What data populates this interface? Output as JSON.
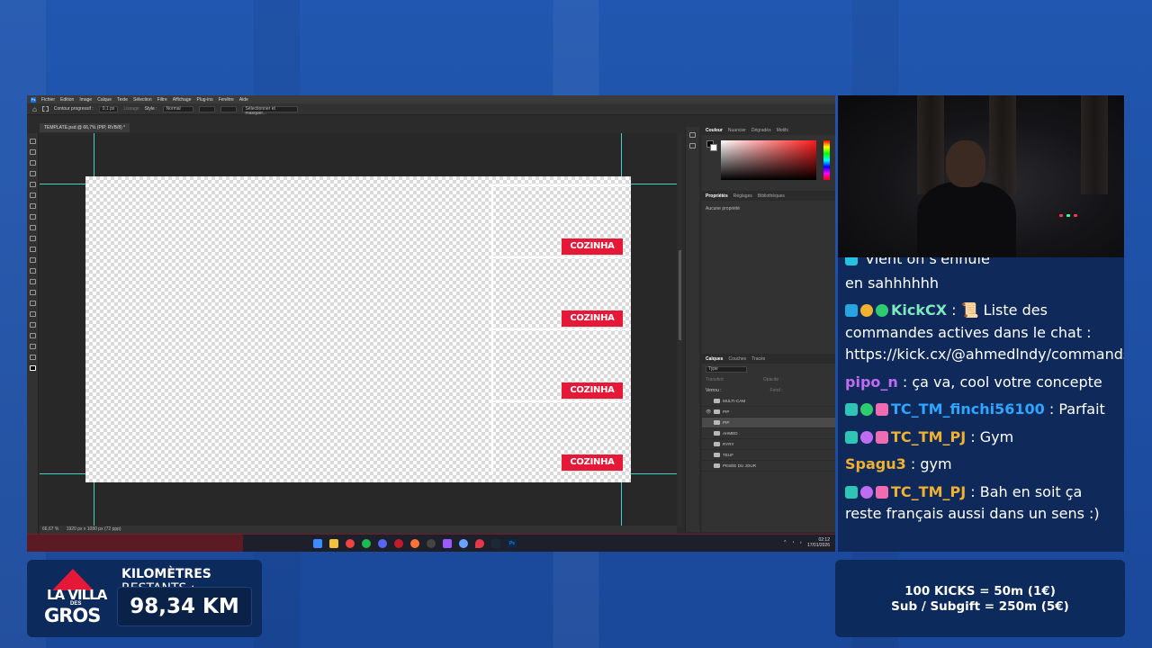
{
  "photoshop": {
    "menu": [
      "Fichier",
      "Edition",
      "Image",
      "Calque",
      "Texte",
      "Sélection",
      "Filtre",
      "Affichage",
      "Plug-ins",
      "Fenêtre",
      "Aide"
    ],
    "options": {
      "contour_label": "Contour progressif :",
      "contour_value": "0,1 px",
      "lisser": "Lissage",
      "style_label": "Style :",
      "style_value": "Normal",
      "select_mask": "Sélectionner et masquer..."
    },
    "doc_tab": "TEMPLATE.psd @ 66,7% (PIP, RVB/8) *",
    "slot_labels": [
      "COZINHA",
      "COZINHA",
      "COZINHA",
      "COZINHA"
    ],
    "status_zoom": "66,67 %",
    "status_size": "1920 px x 1080 px (72 ppp)",
    "color_tabs": [
      "Couleur",
      "Nuancier",
      "Dégradés",
      "Motifs"
    ],
    "props_tabs": [
      "Propriétés",
      "Réglages",
      "Bibliothèques"
    ],
    "props_empty": "Aucune propriété",
    "layers_tabs": [
      "Calques",
      "Couches",
      "Tracés"
    ],
    "layers_filter": "Type",
    "layers_lock": "Verrou :",
    "layers_opacity": "Opacité :",
    "layers_fill": "Fond :",
    "layers_mode": "Transfert",
    "layers": [
      {
        "name": "MULTI-CAM",
        "visible": false,
        "selected": false
      },
      {
        "name": "PIP",
        "visible": true,
        "selected": false
      },
      {
        "name": "PIP",
        "visible": false,
        "selected": true
      },
      {
        "name": "AHMED",
        "visible": false,
        "selected": false
      },
      {
        "name": "RYRY",
        "visible": false,
        "selected": false
      },
      {
        "name": "TEUF",
        "visible": false,
        "selected": false
      },
      {
        "name": "PESÉE DU JOUR",
        "visible": false,
        "selected": false
      }
    ],
    "clock_time": "02:12",
    "clock_date": "17/01/2026"
  },
  "chat": {
    "partial_top": "Vient on s'ennuie",
    "messages": [
      {
        "user": "",
        "text": "en sahhhhhh",
        "color": "#ffffff"
      },
      {
        "user": "KickCX",
        "text": "📜 Liste des commandes actives dans le chat : https://kick.cx/@ahmedlndy/commands",
        "color": "#7ee9c0"
      },
      {
        "user": "pipo_n",
        "text": "ça va, cool votre concepte",
        "color": "#c06cf0"
      },
      {
        "user": "TC_TM_finchi56100",
        "text": "Parfait",
        "color": "#2fa5ff"
      },
      {
        "user": "TC_TM_PJ",
        "text": "Gym",
        "color": "#f0b030"
      },
      {
        "user": "Spagu3",
        "text": "gym",
        "color": "#f0b030"
      },
      {
        "user": "TC_TM_PJ",
        "text": "Bah en soit ça reste français aussi dans un sens :)",
        "color": "#f0b030"
      }
    ]
  },
  "km": {
    "logo_line1": "LA VILLA",
    "logo_sub": "DES",
    "logo_line2": "GROS",
    "title_bold": "KILOMÈTRES",
    "title_rest": " RESTANTS :",
    "value": "98,34 KM"
  },
  "kicks": {
    "line1": "100 KICKS = 50m (1€)",
    "line2": "Sub / Subgift = 250m (5€)"
  },
  "colors": {
    "accent_red": "#e51937",
    "panel_navy": "#0d2a5c",
    "guide_cyan": "#3fd3c3"
  }
}
